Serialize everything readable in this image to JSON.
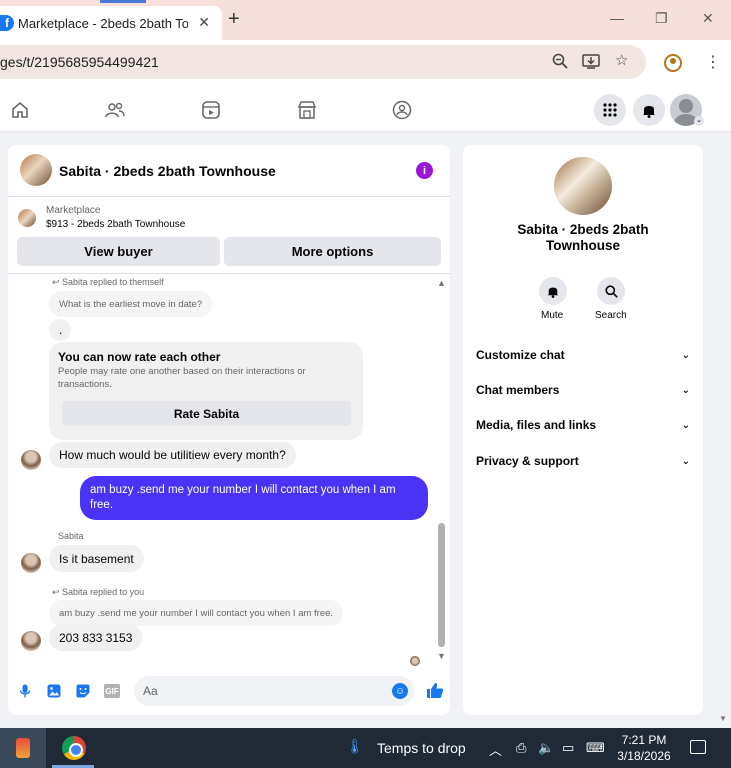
{
  "browser": {
    "tab_title": "Marketplace - 2beds 2bath Tow",
    "tab_close": "✕",
    "new_tab": "+",
    "url": "ges/t/2195685954499421",
    "window_controls": [
      "—",
      "❐",
      "✕"
    ]
  },
  "chat": {
    "header_name": "Sabita · 2beds 2bath Townhouse",
    "info_icon": "i",
    "marketplace_label": "Marketplace",
    "marketplace_item": "$913 - 2beds 2bath Townhouse",
    "view_buyer": "View buyer",
    "more_options": "More options",
    "messages": {
      "reply1_note": "Sabita replied to themself",
      "reply1_quote": "What is the earliest move in date?",
      "reply1_text": ".",
      "rate_title": "You can now rate each other",
      "rate_desc": "People may rate one another based on their interactions or transactions.",
      "rate_button": "Rate Sabita",
      "msg_utilities": "How much would be utilitiew every month?",
      "msg_out": "am buzy .send me your number I will contact you when I am free.",
      "sender_name": "Sabita",
      "msg_basement": "Is it basement",
      "reply2_note": "Sabita replied to you",
      "reply2_quote": "am buzy .send me your number I will contact you when I am free.",
      "msg_number": "203 833 3153"
    },
    "composer_placeholder": "Aa"
  },
  "info_panel": {
    "title": "Sabita · 2beds 2bath Townhouse",
    "mute_label": "Mute",
    "search_label": "Search",
    "rows": [
      "Customize chat",
      "Chat members",
      "Media, files and links",
      "Privacy & support"
    ]
  },
  "taskbar": {
    "weather_text": "Temps to drop",
    "time": "7:21 PM",
    "date": "3/18/2026"
  },
  "colors": {
    "outgoing_bubble": "#4b33f5",
    "fb_blue": "#1877f2",
    "info_purple": "#9b17d6"
  }
}
